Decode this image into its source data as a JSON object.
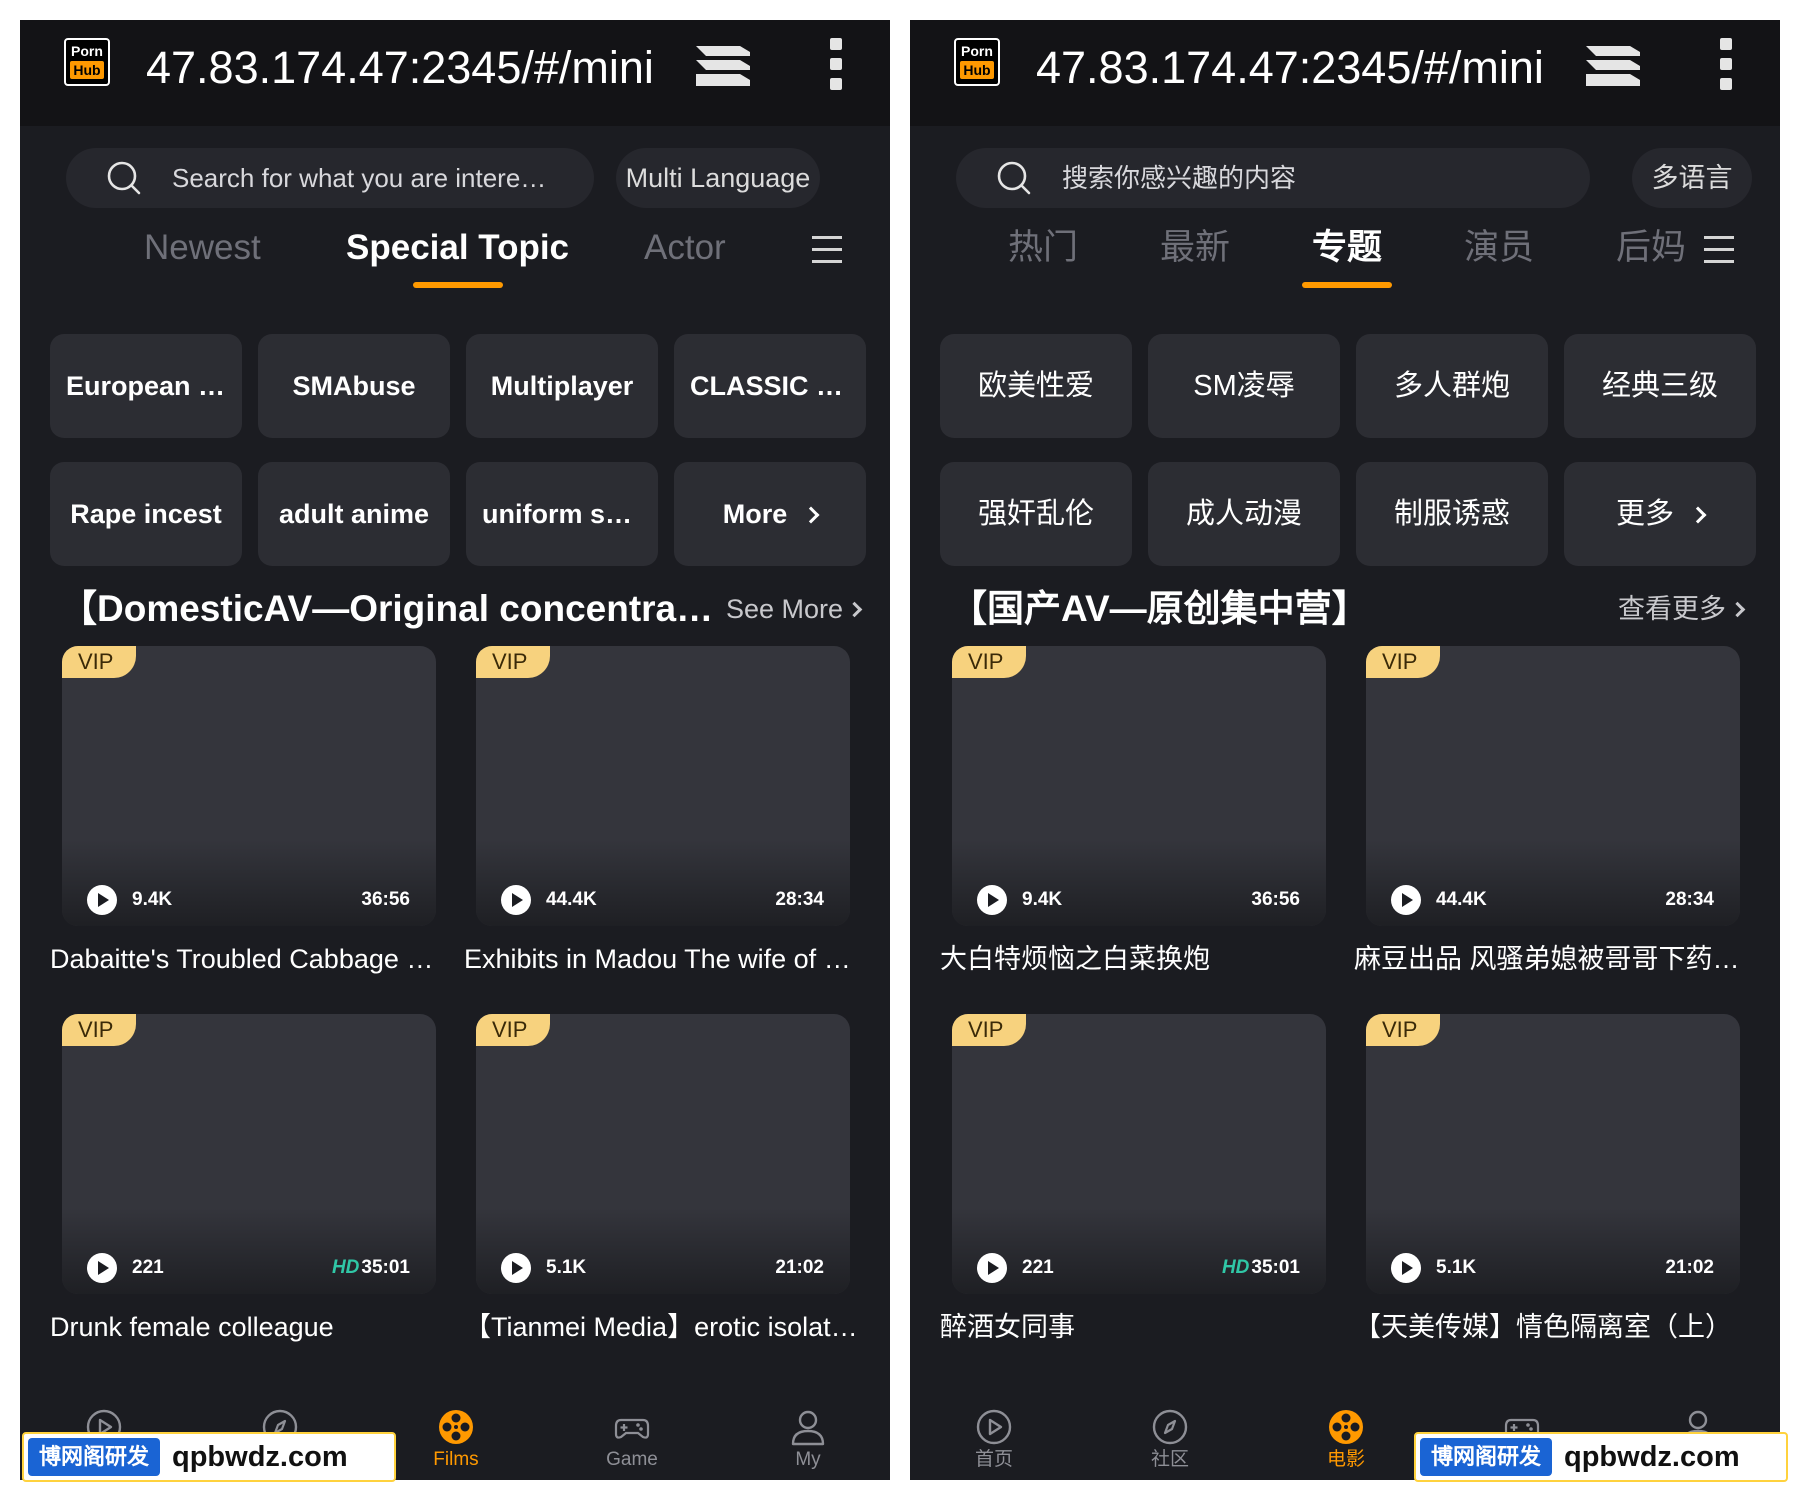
{
  "browser": {
    "logo_top": "Porn",
    "logo_bottom": "Hub",
    "url": "47.83.174.47:2345/#/mini"
  },
  "colors": {
    "accent": "#ff9900",
    "background": "#1b1c21",
    "vip_badge": "#f7d27e",
    "hd_badge": "#30c7a6",
    "watermark_blue": "#1a64d4"
  },
  "screens": {
    "en": {
      "search_placeholder": "Search for what you are interested in",
      "language_button": "Multi Language",
      "tabs": [
        {
          "label": "Newest",
          "active": false
        },
        {
          "label": "Special Topic",
          "active": true
        },
        {
          "label": "Actor",
          "active": false
        }
      ],
      "topics": [
        "European and American sex",
        "SMAbuse",
        "Multiplayer",
        "CLASSIC LEVEL III",
        "Rape incest",
        "adult anime",
        "uniform seduction",
        "More"
      ],
      "section": {
        "title": "【DomesticAV—Original concentration camp】",
        "see_more": "See More"
      },
      "videos": [
        {
          "badge": "VIP",
          "views": "9.4K",
          "duration": "36:56",
          "hd": "",
          "title": "Dabaitte's Troubled Cabbage Cannon"
        },
        {
          "badge": "VIP",
          "views": "44.4K",
          "duration": "28:34",
          "hd": "",
          "title": "Exhibits in Madou  The wife of the"
        },
        {
          "badge": "VIP",
          "views": "221",
          "duration": "35:01",
          "hd": "HD",
          "title": "Drunk female colleague"
        },
        {
          "badge": "VIP",
          "views": "5.1K",
          "duration": "21:02",
          "hd": "",
          "title": "【Tianmei Media】erotic isolation room"
        }
      ],
      "nav": [
        {
          "label": "",
          "icon": "play-circle-icon",
          "active": false
        },
        {
          "label": "",
          "icon": "compass-icon",
          "active": false
        },
        {
          "label": "Films",
          "icon": "film-reel-icon",
          "active": true
        },
        {
          "label": "Game",
          "icon": "gamepad-icon",
          "active": false
        },
        {
          "label": "My",
          "icon": "user-icon",
          "active": false
        }
      ]
    },
    "zh": {
      "search_placeholder": "搜索你感兴趣的内容",
      "language_button": "多语言",
      "tabs": [
        {
          "label": "热门",
          "active": false
        },
        {
          "label": "最新",
          "active": false
        },
        {
          "label": "专题",
          "active": true
        },
        {
          "label": "演员",
          "active": false
        },
        {
          "label": "后妈",
          "active": false
        }
      ],
      "topics": [
        "欧美性爱",
        "SM凌辱",
        "多人群炮",
        "经典三级",
        "强奸乱伦",
        "成人动漫",
        "制服诱惑",
        "更多"
      ],
      "section": {
        "title": "【国产AV—原创集中营】",
        "see_more": "查看更多"
      },
      "videos": [
        {
          "badge": "VIP",
          "views": "9.4K",
          "duration": "36:56",
          "hd": "",
          "title": "大白特烦恼之白菜换炮"
        },
        {
          "badge": "VIP",
          "views": "44.4K",
          "duration": "28:34",
          "hd": "",
          "title": "麻豆出品  风骚弟媳被哥哥下药迷奸"
        },
        {
          "badge": "VIP",
          "views": "221",
          "duration": "35:01",
          "hd": "HD",
          "title": "醉酒女同事"
        },
        {
          "badge": "VIP",
          "views": "5.1K",
          "duration": "21:02",
          "hd": "",
          "title": "【天美传媒】情色隔离室（上）"
        }
      ],
      "nav": [
        {
          "label": "首页",
          "icon": "play-circle-icon",
          "active": false
        },
        {
          "label": "社区",
          "icon": "compass-icon",
          "active": false
        },
        {
          "label": "电影",
          "icon": "film-reel-icon",
          "active": true
        },
        {
          "label": "",
          "icon": "gamepad-icon",
          "active": false
        },
        {
          "label": "",
          "icon": "user-icon",
          "active": false
        }
      ]
    }
  },
  "watermark": {
    "badge": "博网阁研发",
    "site": "qpbwdz.com"
  }
}
